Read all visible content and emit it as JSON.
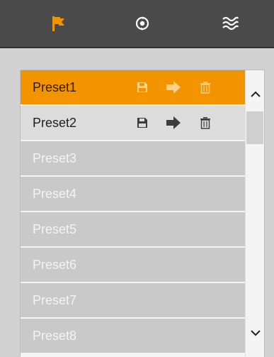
{
  "toolbar": {
    "tabs": [
      {
        "icon": "flag-icon",
        "active": true
      },
      {
        "icon": "cruise-icon",
        "active": false
      },
      {
        "icon": "waves-icon",
        "active": false
      }
    ]
  },
  "presets": {
    "items": [
      {
        "label": "Preset1",
        "state": "active",
        "actions": [
          "save",
          "call",
          "delete"
        ]
      },
      {
        "label": "Preset2",
        "state": "saved",
        "actions": [
          "save",
          "call",
          "delete"
        ]
      },
      {
        "label": "Preset3",
        "state": "empty"
      },
      {
        "label": "Preset4",
        "state": "empty"
      },
      {
        "label": "Preset5",
        "state": "empty"
      },
      {
        "label": "Preset6",
        "state": "empty"
      },
      {
        "label": "Preset7",
        "state": "empty"
      },
      {
        "label": "Preset8",
        "state": "empty"
      }
    ]
  },
  "colors": {
    "accent": "#f29400",
    "toolbar_bg": "#4a4a4a",
    "row_empty": "#c9c9c9",
    "row_saved": "#dcdcdc"
  }
}
